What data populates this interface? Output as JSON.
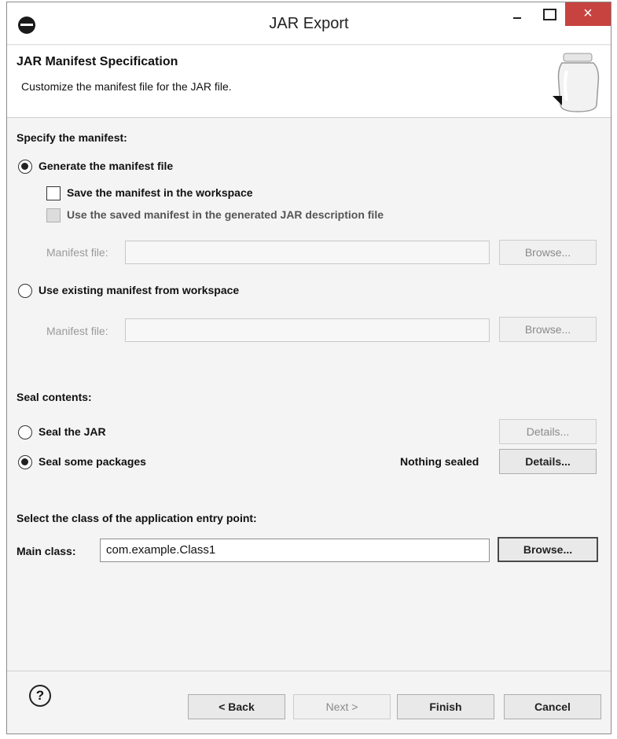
{
  "window": {
    "title": "JAR Export",
    "close_glyph": "×"
  },
  "header": {
    "title": "JAR Manifest Specification",
    "description": "Customize the manifest file for the JAR file."
  },
  "manifest": {
    "section_label": "Specify the manifest:",
    "generate_option": "Generate the manifest file",
    "generate_selected": true,
    "save_checkbox": "Save the manifest in the workspace",
    "save_checked": false,
    "use_saved_checkbox": "Use the saved manifest in the generated JAR description file",
    "use_saved_enabled": false,
    "manifest_file_label_1": "Manifest file:",
    "manifest_file_value_1": "",
    "browse_1": "Browse...",
    "existing_option": "Use existing manifest from workspace",
    "existing_selected": false,
    "manifest_file_label_2": "Manifest file:",
    "manifest_file_value_2": "",
    "browse_2": "Browse..."
  },
  "seal": {
    "section_label": "Seal contents:",
    "seal_jar_option": "Seal the JAR",
    "seal_jar_selected": false,
    "details_1": "Details...",
    "seal_packages_option": "Seal some packages",
    "seal_packages_selected": true,
    "status": "Nothing sealed",
    "details_2": "Details..."
  },
  "entry_point": {
    "section_label": "Select the class of the application entry point:",
    "main_class_label": "Main class:",
    "main_class_value": "com.example.Class1",
    "browse": "Browse..."
  },
  "footer": {
    "help_glyph": "?",
    "back": "< Back",
    "next": "Next >",
    "finish": "Finish",
    "cancel": "Cancel"
  },
  "icons": [
    "app-icon",
    "minimize-icon",
    "maximize-icon",
    "close-icon",
    "jar-icon",
    "help-icon"
  ]
}
